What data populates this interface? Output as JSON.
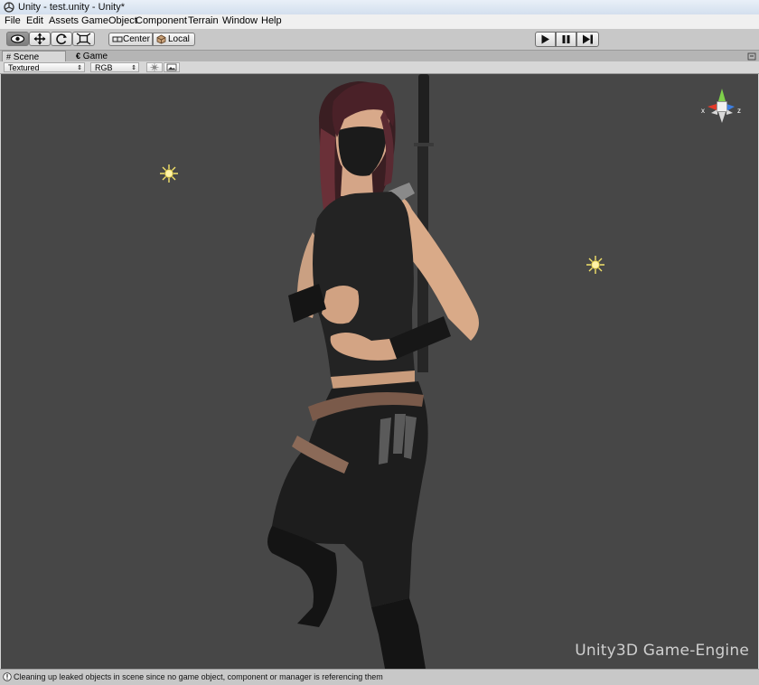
{
  "window": {
    "title": "Unity - test.unity - Unity*"
  },
  "menu": [
    "File",
    "Edit",
    "Assets",
    "GameObject",
    "Component",
    "Terrain",
    "Window",
    "Help"
  ],
  "toolbar": {
    "tools": [
      "view-hand",
      "move",
      "rotate",
      "scale"
    ],
    "active_tool": "view-hand",
    "pivot_mode": "Center",
    "pivot_space": "Local",
    "playback": [
      "play",
      "pause",
      "step"
    ]
  },
  "tabs": [
    {
      "label": "Scene",
      "active": true
    },
    {
      "label": "Game",
      "active": false
    }
  ],
  "scene_options": {
    "render_mode": "Textured",
    "color_mode": "RGB"
  },
  "gizmo": {
    "x_label": "x",
    "z_label": "z"
  },
  "watermark": "Unity3D Game-Engine",
  "status": {
    "message": "Cleaning up leaked objects in scene since no game object, component or manager is referencing them"
  },
  "colors": {
    "viewport_bg": "#474747",
    "light_icon": "#f4e36a",
    "gizmo_x": "#e23b2a",
    "gizmo_y": "#7fd04a",
    "gizmo_z": "#3d7ee0"
  }
}
